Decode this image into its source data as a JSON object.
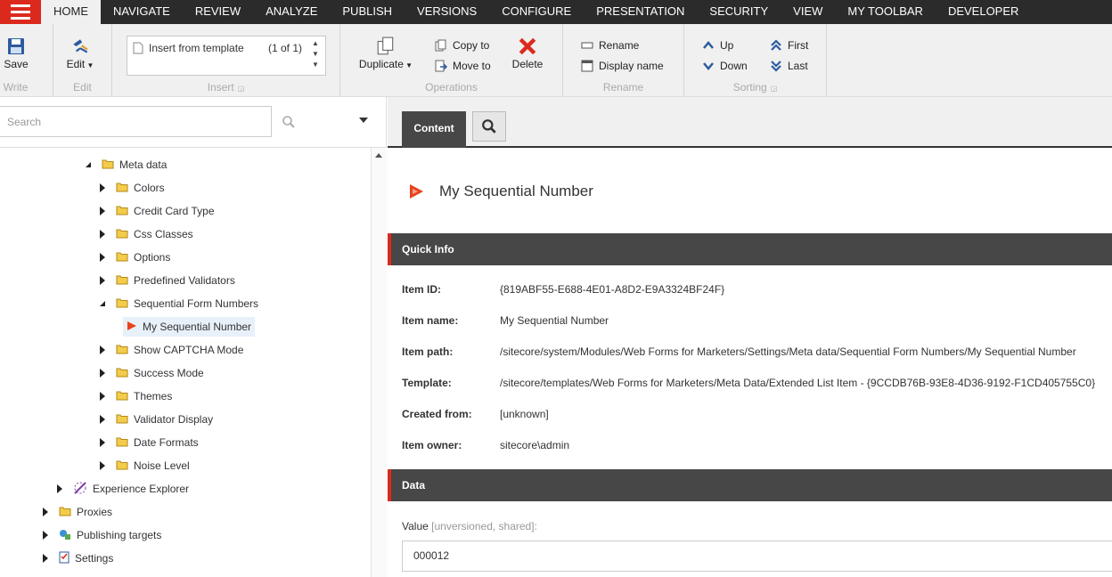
{
  "ribbon_tabs": [
    "HOME",
    "NAVIGATE",
    "REVIEW",
    "ANALYZE",
    "PUBLISH",
    "VERSIONS",
    "CONFIGURE",
    "PRESENTATION",
    "SECURITY",
    "VIEW",
    "MY TOOLBAR",
    "DEVELOPER"
  ],
  "ribbon": {
    "write": {
      "save": "Save",
      "label": "Write"
    },
    "edit": {
      "edit": "Edit",
      "label": "Edit"
    },
    "insert": {
      "item": "Insert from template",
      "count": "(1 of 1)",
      "label": "Insert"
    },
    "operations": {
      "duplicate": "Duplicate",
      "copy_to": "Copy to",
      "move_to": "Move to",
      "delete": "Delete",
      "label": "Operations"
    },
    "rename": {
      "rename": "Rename",
      "display_name": "Display name",
      "label": "Rename"
    },
    "sorting": {
      "up": "Up",
      "down": "Down",
      "first": "First",
      "last": "Last",
      "label": "Sorting"
    }
  },
  "search": {
    "placeholder": "Search"
  },
  "tree": [
    {
      "label": "Meta data",
      "toggle": "expanded",
      "icon": "folder-icon"
    },
    {
      "label": "Colors",
      "toggle": "collapsed",
      "icon": "folder-icon"
    },
    {
      "label": "Credit Card Type",
      "toggle": "collapsed",
      "icon": "folder-icon"
    },
    {
      "label": "Css Classes",
      "toggle": "collapsed",
      "icon": "folder-icon"
    },
    {
      "label": "Options",
      "toggle": "collapsed",
      "icon": "folder-icon"
    },
    {
      "label": "Predefined Validators",
      "toggle": "collapsed",
      "icon": "folder-icon"
    },
    {
      "label": "Sequential Form Numbers",
      "toggle": "expanded",
      "icon": "folder-icon"
    },
    {
      "label": "My Sequential Number",
      "toggle": "none",
      "icon": "sequential-item-icon",
      "selected": true
    },
    {
      "label": "Show CAPTCHA Mode",
      "toggle": "collapsed",
      "icon": "folder-icon"
    },
    {
      "label": "Success Mode",
      "toggle": "collapsed",
      "icon": "folder-icon"
    },
    {
      "label": "Themes",
      "toggle": "collapsed",
      "icon": "folder-icon"
    },
    {
      "label": "Validator Display",
      "toggle": "collapsed",
      "icon": "folder-icon"
    },
    {
      "label": "Date Formats",
      "toggle": "collapsed",
      "icon": "folder-icon"
    },
    {
      "label": "Noise Level",
      "toggle": "collapsed",
      "icon": "folder-icon"
    },
    {
      "label": "Experience Explorer",
      "toggle": "collapsed",
      "icon": "experience-explorer-icon"
    },
    {
      "label": "Proxies",
      "toggle": "collapsed",
      "icon": "folder-icon"
    },
    {
      "label": "Publishing targets",
      "toggle": "collapsed",
      "icon": "publishing-targets-icon"
    },
    {
      "label": "Settings",
      "toggle": "collapsed",
      "icon": "settings-checklist-icon"
    }
  ],
  "content": {
    "tab": "Content",
    "item_title": "My Sequential Number",
    "quick_info_title": "Quick Info",
    "quick_info": [
      {
        "key": "Item ID:",
        "value": "{819ABF55-E688-4E01-A8D2-E9A3324BF24F}"
      },
      {
        "key": "Item name:",
        "value": "My Sequential Number"
      },
      {
        "key": "Item path:",
        "value": "/sitecore/system/Modules/Web Forms for Marketers/Settings/Meta data/Sequential Form Numbers/My Sequential Number"
      },
      {
        "key": "Template:",
        "value": "/sitecore/templates/Web Forms for Marketers/Meta Data/Extended List Item - {9CCDB76B-93E8-4D36-9192-F1CD405755C0}"
      },
      {
        "key": "Created from:",
        "value": "[unknown]"
      },
      {
        "key": "Item owner:",
        "value": "sitecore\\admin"
      }
    ],
    "data_title": "Data",
    "value_label": "Value",
    "value_sub": "[unversioned, shared]:",
    "value": "000012"
  },
  "colors": {
    "accent": "#dc291e",
    "dark": "#2b2b2b",
    "section": "#474747"
  }
}
